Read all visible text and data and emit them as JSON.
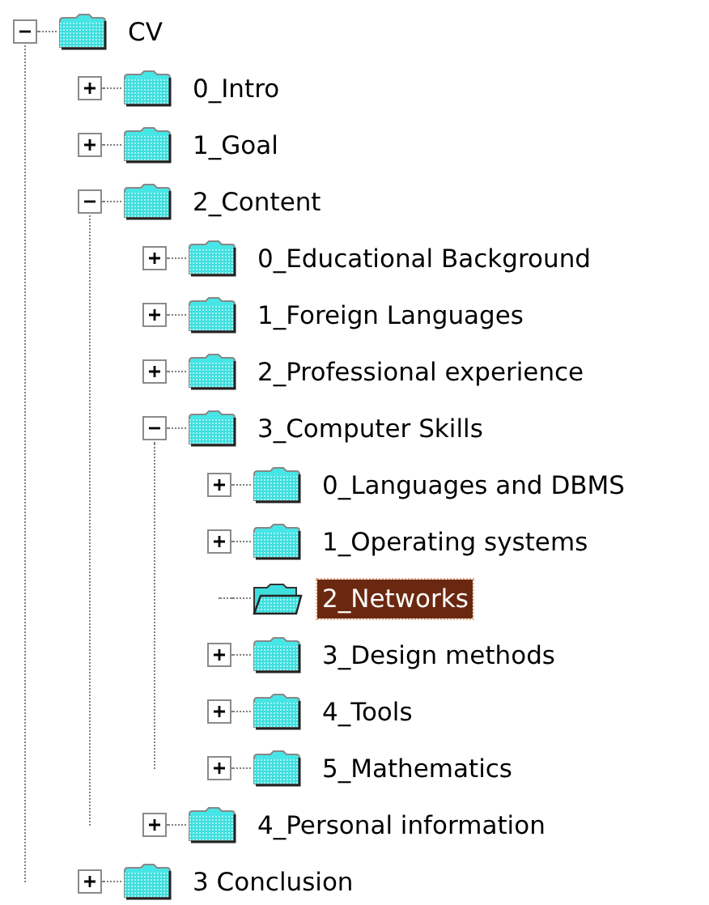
{
  "tree": [
    {
      "label": "CV",
      "kind": "branch",
      "expanded": true,
      "selected": false,
      "children": [
        {
          "label": "0_Intro",
          "kind": "branch",
          "expanded": false,
          "selected": false
        },
        {
          "label": "1_Goal",
          "kind": "branch",
          "expanded": false,
          "selected": false
        },
        {
          "label": "2_Content",
          "kind": "branch",
          "expanded": true,
          "selected": false,
          "children": [
            {
              "label": "0_Educational Background",
              "kind": "branch",
              "expanded": false,
              "selected": false
            },
            {
              "label": "1_Foreign Languages",
              "kind": "branch",
              "expanded": false,
              "selected": false
            },
            {
              "label": "2_Professional experience",
              "kind": "branch",
              "expanded": false,
              "selected": false
            },
            {
              "label": "3_Computer Skills",
              "kind": "branch",
              "expanded": true,
              "selected": false,
              "children": [
                {
                  "label": "0_Languages and DBMS",
                  "kind": "branch",
                  "expanded": false,
                  "selected": false
                },
                {
                  "label": "1_Operating systems",
                  "kind": "branch",
                  "expanded": false,
                  "selected": false
                },
                {
                  "label": "2_Networks",
                  "kind": "leaf",
                  "selected": true
                },
                {
                  "label": "3_Design methods",
                  "kind": "branch",
                  "expanded": false,
                  "selected": false
                },
                {
                  "label": "4_Tools",
                  "kind": "branch",
                  "expanded": false,
                  "selected": false
                },
                {
                  "label": "5_Mathematics",
                  "kind": "branch",
                  "expanded": false,
                  "selected": false
                }
              ]
            },
            {
              "label": "4_Personal information",
              "kind": "branch",
              "expanded": false,
              "selected": false
            }
          ]
        },
        {
          "label": "3 Conclusion",
          "kind": "branch",
          "expanded": false,
          "selected": false
        }
      ]
    }
  ]
}
